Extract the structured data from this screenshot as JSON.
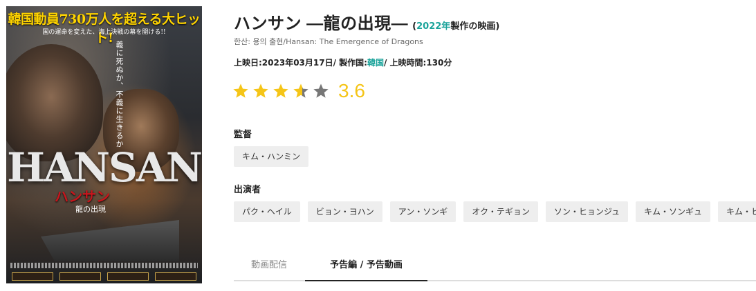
{
  "poster": {
    "headline": "韓国動員730万人を超える大ヒット!",
    "tagline": "国の運命を変えた、海上決戦の幕を開ける!!",
    "vertical_text": "義に死ぬか、不義に生きるか",
    "title_en": "HANSAN",
    "title_ja": "ハンサン",
    "subtitle": "龍の出現"
  },
  "movie": {
    "title": "ハンサン —龍の出現—",
    "meta_open": "(",
    "year": "2022年",
    "meta_close": "製作の映画)",
    "alt_titles": "한산: 용의 출현/Hansan: The Emergence of Dragons",
    "release_label": "上映日:2023年03月17日/ 製作国:",
    "country": "韓国",
    "runtime": "/ 上映時間:130分"
  },
  "rating": {
    "score": "3.6",
    "value": 3.6,
    "max": 5,
    "star_color": "#f5c518",
    "empty_color": "#777777"
  },
  "director": {
    "label": "監督",
    "names": [
      "キム・ハンミン"
    ]
  },
  "cast": {
    "label": "出演者",
    "names": [
      "パク・ヘイル",
      "ビョン・ヨハン",
      "アン・ソンギ",
      "オク・テギョン",
      "ソン・ヒョンジュ",
      "キム・ソンギュ",
      "キム・ヒャンギ"
    ]
  },
  "tabs": [
    "動画配信",
    "予告編 / 予告動画"
  ],
  "colors": {
    "accent": "#1aa39a",
    "star": "#f5c518"
  }
}
